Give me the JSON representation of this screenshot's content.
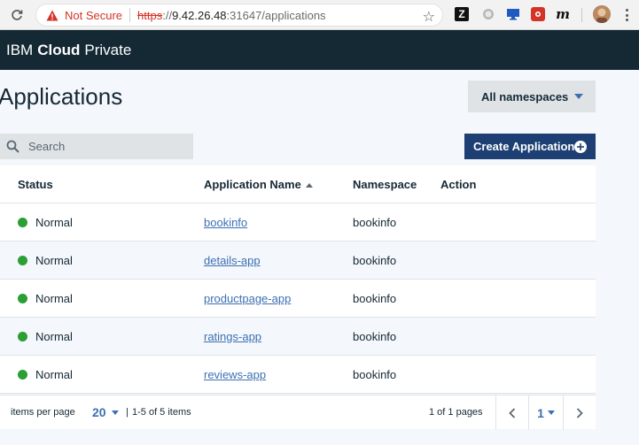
{
  "browser": {
    "security_label": "Not Secure",
    "url_scheme": "https",
    "url_sep": "://",
    "url_host": "9.42.26.48",
    "url_path": ":31647/applications",
    "extensions": [
      "z-extension-icon",
      "circle-extension-icon",
      "monitor-extension-icon",
      "red-extension-icon",
      "m-extension-icon"
    ]
  },
  "header": {
    "brand_prefix": "IBM",
    "brand_bold": "Cloud",
    "brand_suffix": "Private"
  },
  "page": {
    "title": "Applications",
    "namespace_selector": "All namespaces",
    "search_placeholder": "Search",
    "create_button": "Create Application"
  },
  "table": {
    "columns": [
      "Status",
      "Application Name",
      "Namespace",
      "Action"
    ],
    "sorted_column": "Application Name",
    "rows": [
      {
        "status": "Normal",
        "name": "bookinfo",
        "namespace": "bookinfo",
        "action": ""
      },
      {
        "status": "Normal",
        "name": "details-app",
        "namespace": "bookinfo",
        "action": ""
      },
      {
        "status": "Normal",
        "name": "productpage-app",
        "namespace": "bookinfo",
        "action": ""
      },
      {
        "status": "Normal",
        "name": "ratings-app",
        "namespace": "bookinfo",
        "action": ""
      },
      {
        "status": "Normal",
        "name": "reviews-app",
        "namespace": "bookinfo",
        "action": ""
      }
    ]
  },
  "pagination": {
    "items_per_page_label": "items per page",
    "page_size": "20",
    "separator": "|",
    "range_text": "1-5 of 5 items",
    "pages_text": "1 of 1 pages",
    "current_page": "1"
  },
  "colors": {
    "header_bg": "#152935",
    "primary_button": "#1d3f73",
    "link": "#3d70b2",
    "status_normal": "#2b9e34",
    "warning": "#d33426"
  }
}
